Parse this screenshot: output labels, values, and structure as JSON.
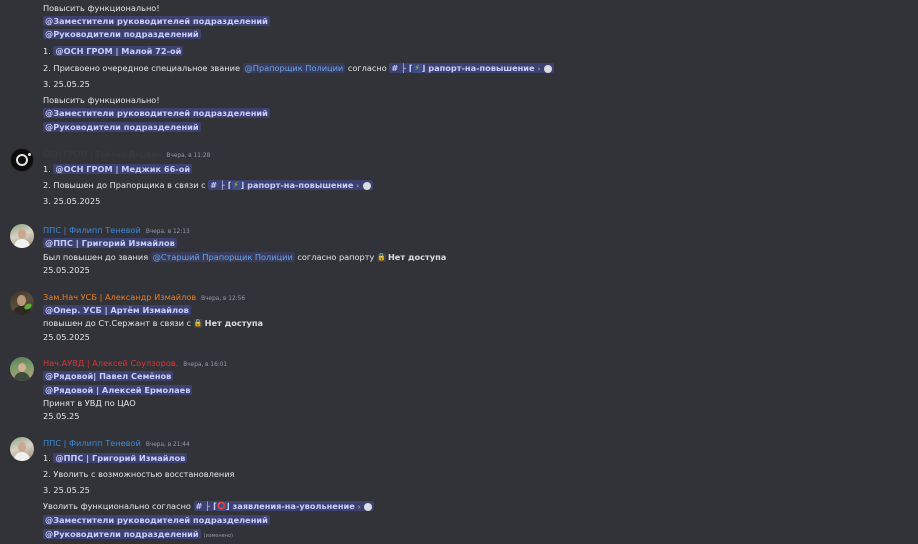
{
  "colors": {
    "background": "#313338",
    "text": "#e3e5e8",
    "mention_bg": "#414774",
    "role_mention": "#6ba4e8",
    "user_blue": "#3e88d6",
    "user_orange": "#e67e22",
    "user_red": "#d93636",
    "timestamp": "#949ba4"
  },
  "top": {
    "l1": "Повысить функционально!",
    "m1": "@Заместители руководителей подразделений",
    "m2": "@Руководители подразделений",
    "l4_prefix": "1. ",
    "l4_mention": "@ОСН ГРОМ | Малой 72-ой",
    "l5_prefix": "2. Присвоено очередное специальное звание ",
    "l5_role": "@Прапорщик Полиции",
    "l5_mid": " согласно ",
    "l5_channel": "рапорт-на-повышение",
    "l6": "3. 25.05.25",
    "l7": "Повысить функционально!",
    "m3": "@Заместители руководителей подразделений",
    "m4": "@Руководители подразделений"
  },
  "msg1": {
    "username": "ОСН ГРОМ | Тайлер Дёрден",
    "timestamp": "Вчера, в 11:28",
    "l1_prefix": "1. ",
    "l1_mention": "@ОСН ГРОМ | Меджик 66-ой",
    "l2_prefix": "2. Повышен до Прапорщика в связи с ",
    "l2_channel": "рапорт-на-повышение",
    "l3": "3. 25.05.2025"
  },
  "msg2": {
    "username": "ППС | Филипп Теневой",
    "timestamp": "Вчера, в 12:13",
    "mention": "@ППС | Григорий Измайлов",
    "l2_prefix": "Был повышен до звания ",
    "l2_role": "@Старший Прапорщик Полиции",
    "l2_mid": " согласно рапорту ",
    "l2_locked": "Нет доступа",
    "l3": "25.05.2025"
  },
  "msg3": {
    "username": "Зам.Нач УСБ | Александр Измайлов",
    "timestamp": "Вчера, в 12:56",
    "mention": "@Опер. УСБ | Артём Измайлов",
    "l2_prefix": "повышен до Ст.Сержант в связи с ",
    "l2_locked": "Нет доступа",
    "l3": "25.05.2025"
  },
  "msg4": {
    "username": "Нач.АУВД | Алексей Соулзоров.",
    "timestamp": "Вчера, в 16:01",
    "mention1": "@Рядовой| Павел Семёнов",
    "mention2": "@Рядовой | Алексей Ермолаев",
    "l3": "Принят в УВД по ЦАО",
    "l4": "25.05.25"
  },
  "msg5": {
    "username": "ППС | Филипп Теневой",
    "timestamp": "Вчера, в 21:44",
    "l1_prefix": "1. ",
    "l1_mention": "@ППС | Григорий Измайлов",
    "l2": "2. Уволить с возможностью восстановления",
    "l3": "3. 25.05.25",
    "l4_prefix": "Уволить функционально согласно ",
    "l4_channel": "заявления-на-увольнение",
    "m1": "@Заместители руководителей подразделений",
    "m2": "@Руководители подразделений",
    "edited": "(изменено)"
  },
  "icons": {
    "hash": "#",
    "branch": "├",
    "bracket_open": "⌈",
    "bracket_close": "⌋",
    "bolt": "⚡",
    "circle": "⭕",
    "arrow": "›",
    "lock": "🔒"
  }
}
